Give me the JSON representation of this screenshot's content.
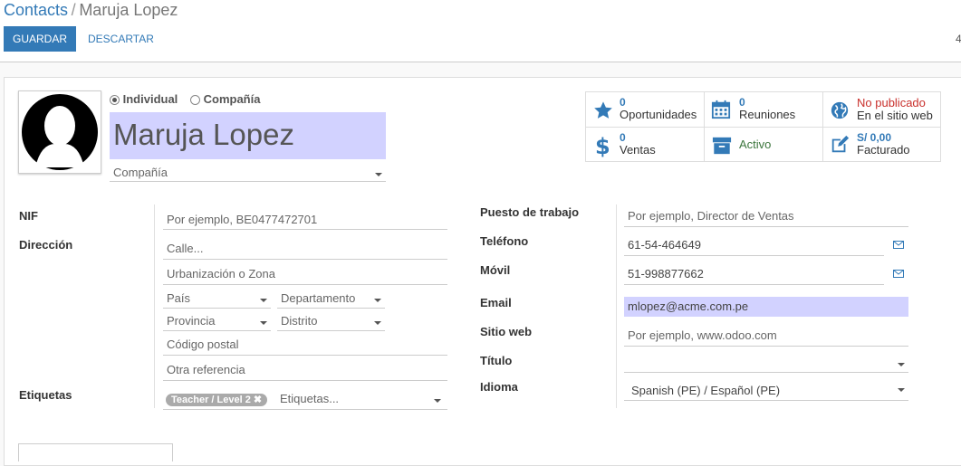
{
  "breadcrumb": {
    "root": "Contacts",
    "separator": "/",
    "current": "Maruja Lopez"
  },
  "toolbar": {
    "save_label": "GUARDAR",
    "discard_label": "DESCARTAR",
    "pager_fragment": "4"
  },
  "type_radio": {
    "individual": "Individual",
    "company": "Compañía",
    "selected": "individual"
  },
  "name": "Maruja Lopez",
  "company_placeholder": "Compañía",
  "smart_buttons": {
    "opportunities": {
      "count": "0",
      "label": "Oportunidades"
    },
    "meetings": {
      "count": "0",
      "label": "Reuniones"
    },
    "website": {
      "status": "No publicado",
      "label": "En el sitio web"
    },
    "sales": {
      "count": "0",
      "label": "Ventas"
    },
    "active": {
      "label": "Activo"
    },
    "invoiced": {
      "amount": "S/ 0,00",
      "label": "Facturado"
    }
  },
  "left_fields": {
    "nif": {
      "label": "NIF",
      "placeholder": "Por ejemplo, BE0477472701"
    },
    "address": {
      "label": "Dirección",
      "street": "Calle...",
      "street2": "Urbanización o Zona",
      "country": "País",
      "state": "Departamento",
      "province": "Provincia",
      "district": "Distrito",
      "zip": "Código postal",
      "reference": "Otra referencia"
    },
    "tags": {
      "label": "Etiquetas",
      "tag": "Teacher / Level 2",
      "placeholder": "Etiquetas..."
    }
  },
  "right_fields": {
    "job": {
      "label": "Puesto de trabajo",
      "placeholder": "Por ejemplo, Director de Ventas"
    },
    "phone": {
      "label": "Teléfono",
      "value": "61-54-464649"
    },
    "mobile": {
      "label": "Móvil",
      "value": "51-998877662"
    },
    "email": {
      "label": "Email",
      "value": "mlopez@acme.com.pe"
    },
    "website": {
      "label": "Sitio web",
      "placeholder": "Por ejemplo, www.odoo.com"
    },
    "title": {
      "label": "Título",
      "value": ""
    },
    "language": {
      "label": "Idioma",
      "value": "Spanish (PE) / Español (PE)"
    }
  },
  "colors": {
    "primary": "#337ab7",
    "highlight": "#d2d2ff",
    "danger": "#c9302c",
    "success": "#3c763d"
  }
}
